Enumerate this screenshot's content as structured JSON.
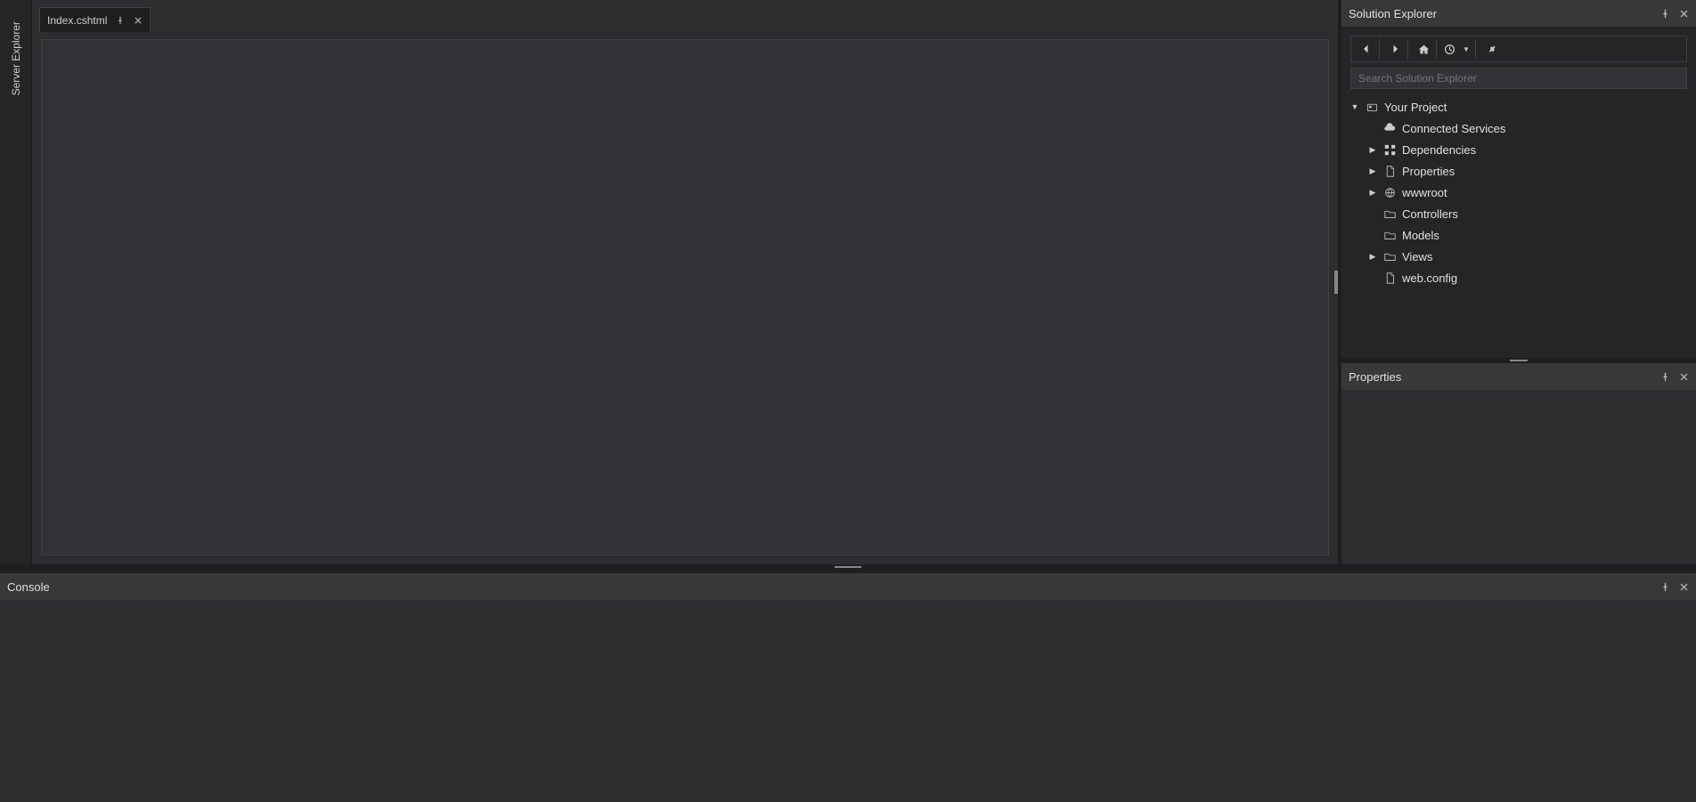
{
  "leftSidebar": {
    "tab": "Server Explorer"
  },
  "editor": {
    "tab": {
      "title": "Index.cshtml"
    }
  },
  "solutionExplorer": {
    "title": "Solution Explorer",
    "searchPlaceholder": "Search Solution Explorer",
    "tree": {
      "root": "Your Project",
      "items": [
        {
          "label": "Connected Services",
          "icon": "cloud",
          "expandable": false
        },
        {
          "label": "Dependencies",
          "icon": "dependencies",
          "expandable": true
        },
        {
          "label": "Properties",
          "icon": "file",
          "expandable": true
        },
        {
          "label": "wwwroot",
          "icon": "globe",
          "expandable": true
        },
        {
          "label": "Controllers",
          "icon": "folder",
          "expandable": false
        },
        {
          "label": "Models",
          "icon": "folder",
          "expandable": false
        },
        {
          "label": "Views",
          "icon": "folder",
          "expandable": true
        },
        {
          "label": "web.config",
          "icon": "file",
          "expandable": false
        }
      ]
    }
  },
  "properties": {
    "title": "Properties"
  },
  "console": {
    "title": "Console"
  }
}
